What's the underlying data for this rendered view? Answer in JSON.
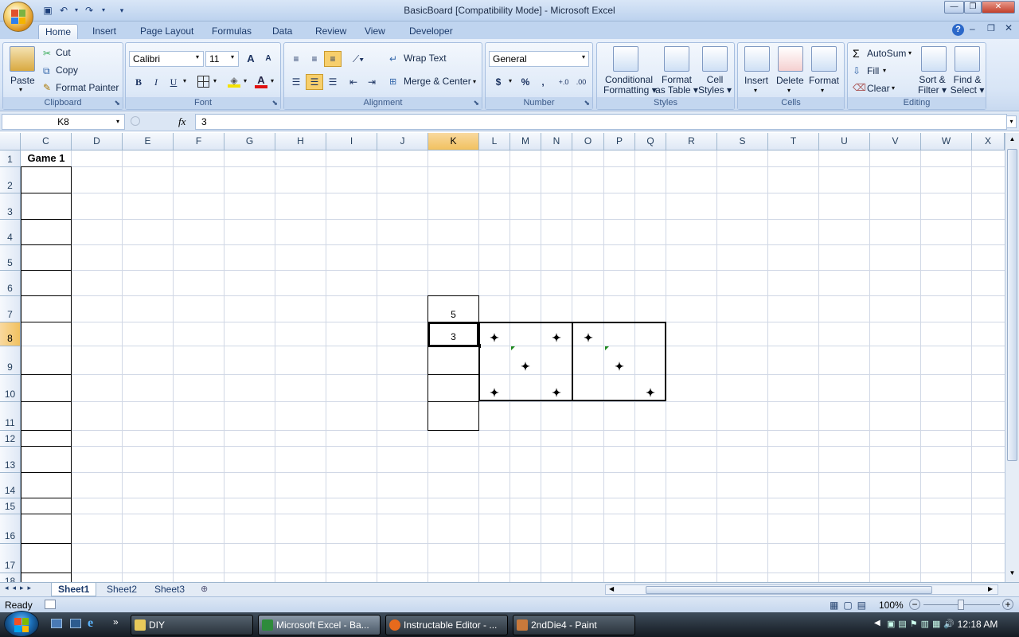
{
  "window": {
    "title": "BasicBoard  [Compatibility Mode] - Microsoft Excel"
  },
  "tabs": [
    "Home",
    "Insert",
    "Page Layout",
    "Formulas",
    "Data",
    "Review",
    "View",
    "Developer"
  ],
  "ribbon": {
    "clipboard": {
      "label": "Clipboard",
      "paste": "Paste",
      "cut": "Cut",
      "copy": "Copy",
      "format_painter": "Format Painter"
    },
    "font": {
      "label": "Font",
      "name": "Calibri",
      "size": "11",
      "bold": "B",
      "italic": "I",
      "underline": "U",
      "grow": "A",
      "shrink": "A"
    },
    "alignment": {
      "label": "Alignment",
      "wrap": "Wrap Text",
      "merge": "Merge & Center"
    },
    "number": {
      "label": "Number",
      "format": "General",
      "currency": "$",
      "percent": "%",
      "comma": ",",
      "inc": "←.0 .00",
      "dec": ".00 →.0"
    },
    "styles": {
      "label": "Styles",
      "cond_1": "Conditional",
      "cond_2": "Formatting",
      "table_1": "Format",
      "table_2": "as Table",
      "cell_1": "Cell",
      "cell_2": "Styles"
    },
    "cells": {
      "label": "Cells",
      "insert": "Insert",
      "delete": "Delete",
      "format": "Format"
    },
    "editing": {
      "label": "Editing",
      "autosum": "AutoSum",
      "fill": "Fill",
      "clear": "Clear",
      "sort_1": "Sort &",
      "sort_2": "Filter",
      "find_1": "Find &",
      "find_2": "Select"
    }
  },
  "formula_bar": {
    "name_box": "K8",
    "fx": "fx",
    "value": "3"
  },
  "columns": [
    "C",
    "D",
    "E",
    "F",
    "G",
    "H",
    "I",
    "J",
    "K",
    "L",
    "M",
    "N",
    "O",
    "P",
    "Q",
    "R",
    "S",
    "T",
    "U",
    "V",
    "W",
    "X"
  ],
  "rows": [
    "1",
    "2",
    "3",
    "4",
    "5",
    "6",
    "7",
    "8",
    "9",
    "10",
    "11",
    "12",
    "13",
    "14",
    "15",
    "16",
    "17",
    "18"
  ],
  "cells": {
    "c1": "Game 1",
    "k7": "5",
    "k8": "3"
  },
  "sheets": [
    "Sheet1",
    "Sheet2",
    "Sheet3"
  ],
  "status": {
    "ready": "Ready",
    "zoom": "100%"
  },
  "taskbar": {
    "items": [
      "DIY",
      "Microsoft Excel - Ba...",
      "Instructable Editor - ...",
      "2ndDie4 - Paint"
    ],
    "clock": "12:18 AM"
  },
  "colors": {
    "ribbon": "#d8e5f6",
    "selected_header": "#f1c15f",
    "taskbar": "#1f2730"
  }
}
